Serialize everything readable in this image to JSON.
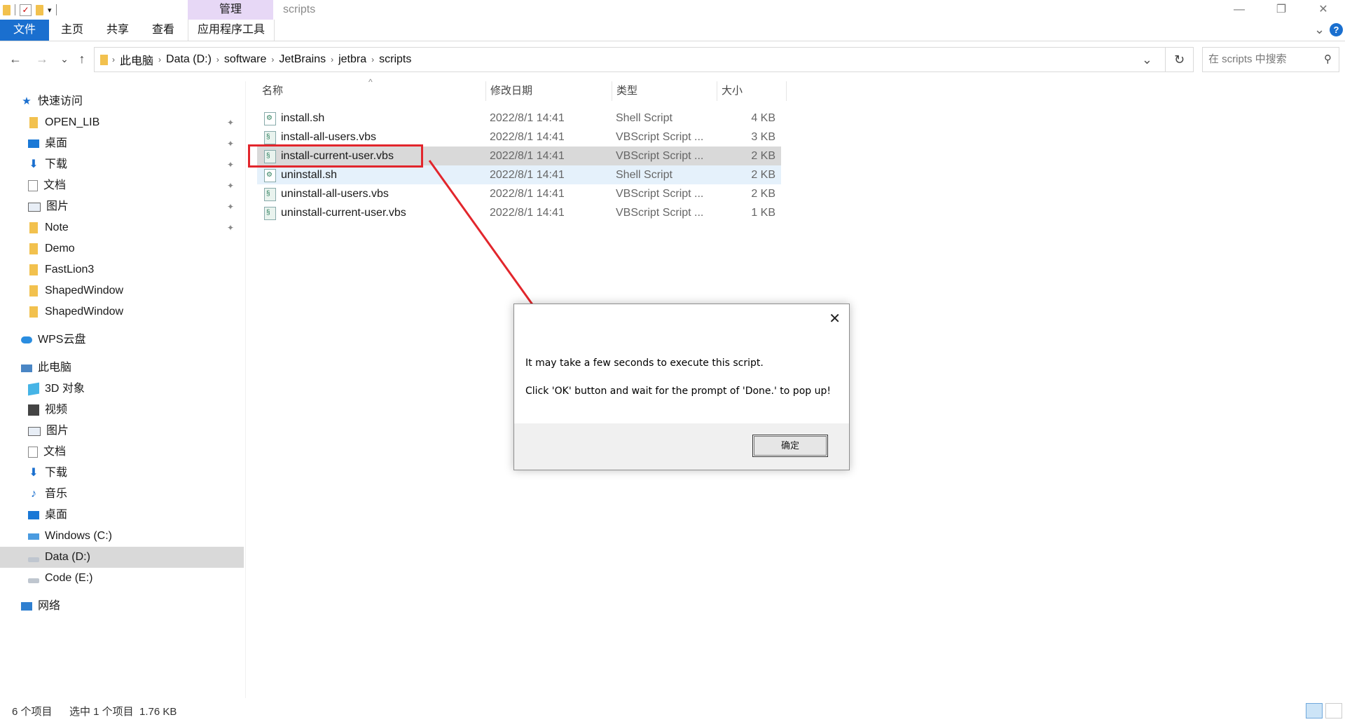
{
  "window": {
    "title": "scripts",
    "manage_tab": "管理",
    "min_icon": "—",
    "restore_icon": "❐",
    "close_icon": "✕"
  },
  "ribbon": {
    "file": "文件",
    "tabs": [
      "主页",
      "共享",
      "查看"
    ],
    "app_tools": "应用程序工具",
    "expand_icon": "⌄",
    "help_icon": "?"
  },
  "address": {
    "crumbs": [
      "此电脑",
      "Data (D:)",
      "software",
      "JetBrains",
      "jetbra",
      "scripts"
    ],
    "separator": "›",
    "dropdown_icon": "⌄",
    "refresh_icon": "↻",
    "back_icon": "←",
    "forward_icon": "→",
    "recent_icon": "⌄",
    "up_icon": "↑",
    "search_placeholder": "在 scripts 中搜索",
    "search_icon": "⚲"
  },
  "nav": {
    "quick_access": "快速访问",
    "quick_items": [
      "OPEN_LIB",
      "桌面",
      "下载",
      "文档",
      "图片",
      "Note",
      "Demo",
      "FastLion3",
      "ShapedWindow",
      "ShapedWindow"
    ],
    "pin_icon": "📌",
    "wps": "WPS云盘",
    "this_pc": "此电脑",
    "pc_items": [
      "3D 对象",
      "视频",
      "图片",
      "文档",
      "下载",
      "音乐",
      "桌面",
      "Windows (C:)",
      "Data (D:)",
      "Code (E:)"
    ],
    "network": "网络"
  },
  "list": {
    "headers": [
      "名称",
      "修改日期",
      "类型",
      "大小"
    ],
    "sort_icon": "^",
    "files": [
      {
        "name": "install.sh",
        "date": "2022/8/1 14:41",
        "type": "Shell Script",
        "size": "4 KB"
      },
      {
        "name": "install-all-users.vbs",
        "date": "2022/8/1 14:41",
        "type": "VBScript Script ...",
        "size": "3 KB"
      },
      {
        "name": "install-current-user.vbs",
        "date": "2022/8/1 14:41",
        "type": "VBScript Script ...",
        "size": "2 KB"
      },
      {
        "name": "uninstall.sh",
        "date": "2022/8/1 14:41",
        "type": "Shell Script",
        "size": "2 KB"
      },
      {
        "name": "uninstall-all-users.vbs",
        "date": "2022/8/1 14:41",
        "type": "VBScript Script ...",
        "size": "2 KB"
      },
      {
        "name": "uninstall-current-user.vbs",
        "date": "2022/8/1 14:41",
        "type": "VBScript Script ...",
        "size": "1 KB"
      }
    ]
  },
  "dialog": {
    "close_icon": "✕",
    "line1": "It may take a few seconds to execute this script.",
    "line2": "Click 'OK' button and wait for the prompt of 'Done.' to pop up!",
    "ok": "确定"
  },
  "status": {
    "count": "6 个项目",
    "selection": "选中 1 个项目  1.76 KB"
  },
  "colors": {
    "accent": "#1a6fcf",
    "annotation": "#e2262c",
    "selected_row": "#d9d9d9",
    "manage_tab": "#e7d8f6"
  }
}
